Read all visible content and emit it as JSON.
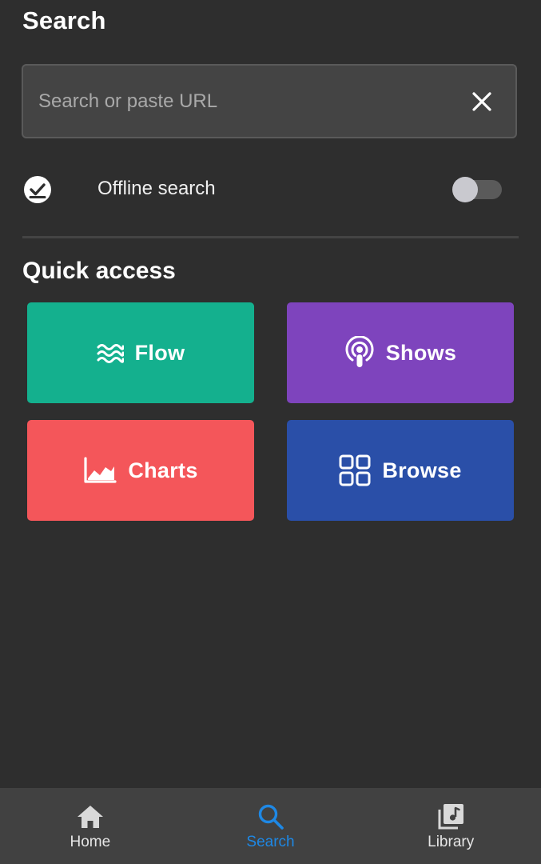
{
  "header": {
    "title": "Search"
  },
  "search": {
    "placeholder": "Search or paste URL",
    "value": "",
    "clear_icon": "close-icon"
  },
  "offline": {
    "label": "Offline search",
    "icon": "offline-check-icon",
    "enabled": false
  },
  "quick_access": {
    "title": "Quick access",
    "tiles": [
      {
        "label": "Flow",
        "icon": "waves-icon",
        "color": "#14b08e"
      },
      {
        "label": "Shows",
        "icon": "podcast-icon",
        "color": "#7e44bd"
      },
      {
        "label": "Charts",
        "icon": "chart-icon",
        "color": "#f4565a"
      },
      {
        "label": "Browse",
        "icon": "grid-icon",
        "color": "#2a4fa8"
      }
    ]
  },
  "bottom_nav": {
    "active_color": "#1e88e5",
    "items": [
      {
        "label": "Home",
        "icon": "home-icon",
        "active": false
      },
      {
        "label": "Search",
        "icon": "search-icon",
        "active": true
      },
      {
        "label": "Library",
        "icon": "library-icon",
        "active": false
      }
    ]
  }
}
